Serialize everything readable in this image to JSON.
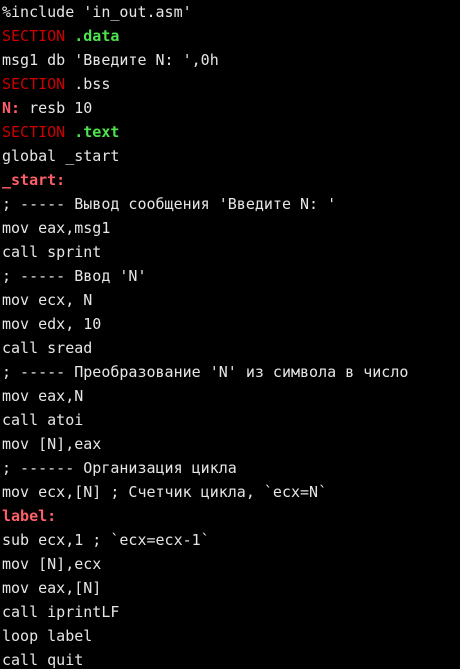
{
  "colors": {
    "background": "#000000",
    "text": "#e6e6e6",
    "section_keyword": "#cc0000",
    "section_name": "#4ee44e",
    "label": "#ff5f6a"
  },
  "lines": [
    [
      {
        "text": "%include 'in_out.asm'",
        "style": "plain"
      }
    ],
    [
      {
        "text": "SECTION",
        "style": "section"
      },
      {
        "text": " ",
        "style": "plain"
      },
      {
        "text": ".data",
        "style": "kw"
      }
    ],
    [
      {
        "text": "msg1 db 'Введите N: ',0h",
        "style": "plain"
      }
    ],
    [
      {
        "text": "SECTION",
        "style": "section"
      },
      {
        "text": " .bss",
        "style": "plain"
      }
    ],
    [
      {
        "text": "N:",
        "style": "label"
      },
      {
        "text": " resb 10",
        "style": "plain"
      }
    ],
    [
      {
        "text": "SECTION",
        "style": "section"
      },
      {
        "text": " ",
        "style": "plain"
      },
      {
        "text": ".text",
        "style": "kw"
      }
    ],
    [
      {
        "text": "global _start",
        "style": "plain"
      }
    ],
    [
      {
        "text": "_start:",
        "style": "label"
      }
    ],
    [
      {
        "text": "; ----- Вывод сообщения 'Введите N: '",
        "style": "plain"
      }
    ],
    [
      {
        "text": "mov eax,msg1",
        "style": "plain"
      }
    ],
    [
      {
        "text": "call sprint",
        "style": "plain"
      }
    ],
    [
      {
        "text": "; ----- Ввод 'N'",
        "style": "plain"
      }
    ],
    [
      {
        "text": "mov ecx, N",
        "style": "plain"
      }
    ],
    [
      {
        "text": "mov edx, 10",
        "style": "plain"
      }
    ],
    [
      {
        "text": "call sread",
        "style": "plain"
      }
    ],
    [
      {
        "text": "; ----- Преобразование 'N' из символа в число",
        "style": "plain"
      }
    ],
    [
      {
        "text": "mov eax,N",
        "style": "plain"
      }
    ],
    [
      {
        "text": "call atoi",
        "style": "plain"
      }
    ],
    [
      {
        "text": "mov [N],eax",
        "style": "plain"
      }
    ],
    [
      {
        "text": "; ------ Организация цикла",
        "style": "plain"
      }
    ],
    [
      {
        "text": "mov ecx,[N] ; Счетчик цикла, `ecx=N`",
        "style": "plain"
      }
    ],
    [
      {
        "text": "label:",
        "style": "label"
      }
    ],
    [
      {
        "text": "sub ecx,1 ; `ecx=ecx-1`",
        "style": "plain"
      }
    ],
    [
      {
        "text": "mov [N],ecx",
        "style": "plain"
      }
    ],
    [
      {
        "text": "mov eax,[N]",
        "style": "plain"
      }
    ],
    [
      {
        "text": "call iprintLF",
        "style": "plain"
      }
    ],
    [
      {
        "text": "loop label",
        "style": "plain"
      }
    ],
    [
      {
        "text": "call quit",
        "style": "plain"
      }
    ]
  ]
}
